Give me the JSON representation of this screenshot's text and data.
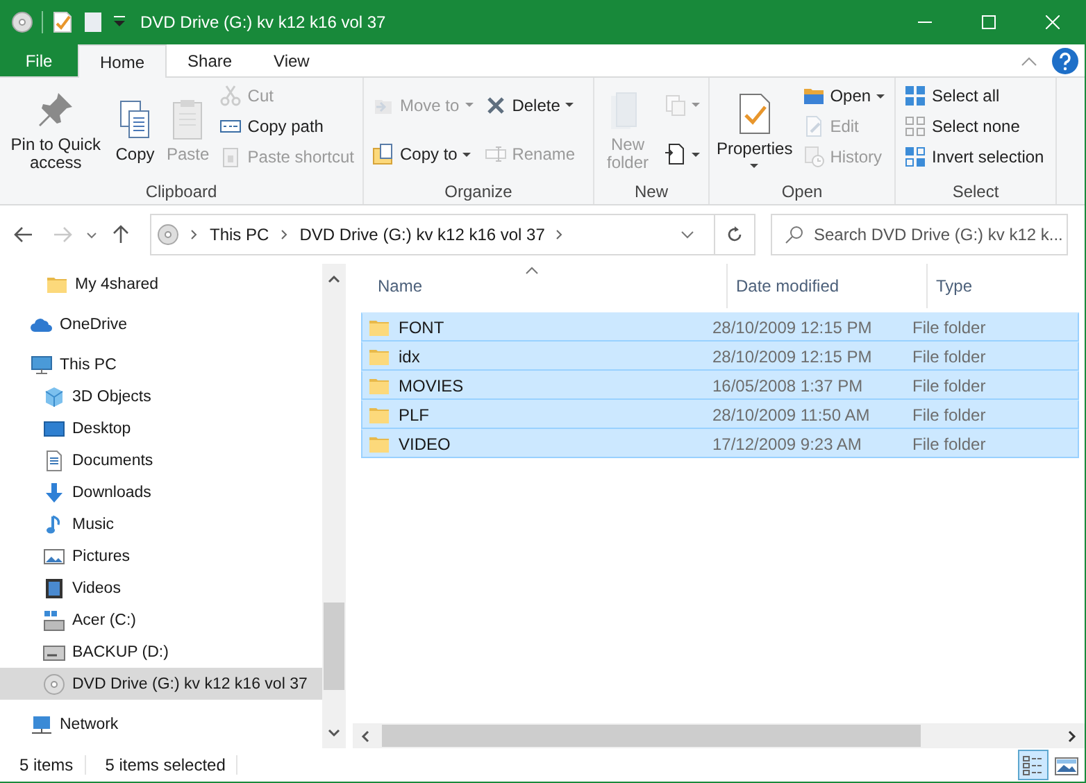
{
  "window": {
    "title": "DVD Drive (G:) kv k12 k16 vol 37"
  },
  "ribbon_tabs": [
    {
      "label": "File",
      "kind": "file",
      "selected": false
    },
    {
      "label": "Home",
      "kind": "tab",
      "selected": true
    },
    {
      "label": "Share",
      "kind": "tab",
      "selected": false
    },
    {
      "label": "View",
      "kind": "tab",
      "selected": false
    }
  ],
  "ribbon_groups": [
    {
      "label": "Clipboard",
      "columns": [
        [
          {
            "label": "Pin to Quick access",
            "kind": "large",
            "disabled": false,
            "dropdown": false
          }
        ],
        [
          {
            "label": "Copy",
            "kind": "large",
            "disabled": false,
            "dropdown": false
          }
        ],
        [
          {
            "label": "Paste",
            "kind": "large",
            "disabled": true,
            "dropdown": false
          }
        ],
        [
          {
            "label": "Cut",
            "kind": "small",
            "disabled": true,
            "dropdown": false
          },
          {
            "label": "Copy path",
            "kind": "small",
            "disabled": false,
            "dropdown": false
          },
          {
            "label": "Paste shortcut",
            "kind": "small",
            "disabled": true,
            "dropdown": false
          }
        ]
      ]
    },
    {
      "label": "Organize",
      "columns": [
        [
          {
            "label": "Move to",
            "kind": "small",
            "disabled": true,
            "dropdown": true
          },
          {
            "label": "Copy to",
            "kind": "small",
            "disabled": false,
            "dropdown": true
          }
        ],
        [
          {
            "label": "Delete",
            "kind": "small",
            "disabled": false,
            "dropdown": true
          },
          {
            "label": "Rename",
            "kind": "small",
            "disabled": true,
            "dropdown": false
          }
        ]
      ]
    },
    {
      "label": "New",
      "columns": [
        [
          {
            "label": "New folder",
            "kind": "large",
            "disabled": true,
            "dropdown": false
          }
        ],
        [
          {
            "kind": "small",
            "disabled": true,
            "dropdown": true
          },
          {
            "kind": "small",
            "disabled": false,
            "dropdown": true
          }
        ]
      ]
    },
    {
      "label": "Open",
      "columns": [
        [
          {
            "label": "Properties",
            "kind": "large",
            "disabled": false,
            "dropdown": true
          }
        ],
        [
          {
            "label": "Open",
            "kind": "small",
            "disabled": false,
            "dropdown": true
          },
          {
            "label": "Edit",
            "kind": "small",
            "disabled": true,
            "dropdown": false
          },
          {
            "label": "History",
            "kind": "small",
            "disabled": true,
            "dropdown": false
          }
        ]
      ]
    },
    {
      "label": "Select",
      "columns": [
        [
          {
            "label": "Select all",
            "kind": "small",
            "disabled": false,
            "dropdown": false
          },
          {
            "label": "Select none",
            "kind": "small",
            "disabled": false,
            "dropdown": false
          },
          {
            "label": "Invert selection",
            "kind": "small",
            "disabled": false,
            "dropdown": false
          }
        ]
      ]
    }
  ],
  "navigation": {
    "back_disabled": false,
    "forward_disabled": true
  },
  "address_bar": {
    "crumbs": [
      "This PC",
      "DVD Drive (G:) kv k12 k16 vol 37"
    ]
  },
  "search": {
    "placeholder": "Search DVD Drive (G:) kv k12 k..."
  },
  "sidebar": {
    "items": [
      {
        "label": "My 4shared",
        "kind": "pinned",
        "selected": false
      },
      {
        "label": "OneDrive",
        "kind": "location",
        "selected": false
      },
      {
        "label": "This PC",
        "kind": "location",
        "selected": false,
        "children": [
          {
            "label": "3D Objects",
            "selected": false
          },
          {
            "label": "Desktop",
            "selected": false
          },
          {
            "label": "Documents",
            "selected": false
          },
          {
            "label": "Downloads",
            "selected": false
          },
          {
            "label": "Music",
            "selected": false
          },
          {
            "label": "Pictures",
            "selected": false
          },
          {
            "label": "Videos",
            "selected": false
          },
          {
            "label": "Acer (C:)",
            "selected": false
          },
          {
            "label": "BACKUP (D:)",
            "selected": false
          },
          {
            "label": "DVD Drive (G:) kv k12 k16 vol 37",
            "selected": true
          }
        ]
      },
      {
        "label": "Network",
        "kind": "location",
        "selected": false
      }
    ]
  },
  "table": {
    "columns": [
      "Name",
      "Date modified",
      "Type"
    ],
    "rows": [
      {
        "name": "FONT",
        "date": "28/10/2009 12:15 PM",
        "type": "File folder",
        "selected": true
      },
      {
        "name": "idx",
        "date": "28/10/2009 12:15 PM",
        "type": "File folder",
        "selected": true
      },
      {
        "name": "MOVIES",
        "date": "16/05/2008 1:37 PM",
        "type": "File folder",
        "selected": true
      },
      {
        "name": "PLF",
        "date": "28/10/2009 11:50 AM",
        "type": "File folder",
        "selected": true
      },
      {
        "name": "VIDEO",
        "date": "17/12/2009 9:23 AM",
        "type": "File folder",
        "selected": true
      }
    ]
  },
  "status_bar": {
    "item_count": "5 items",
    "selection": "5 items selected"
  },
  "view_buttons": [
    {
      "kind": "details",
      "selected": true
    },
    {
      "kind": "large_icons",
      "selected": false
    }
  ]
}
